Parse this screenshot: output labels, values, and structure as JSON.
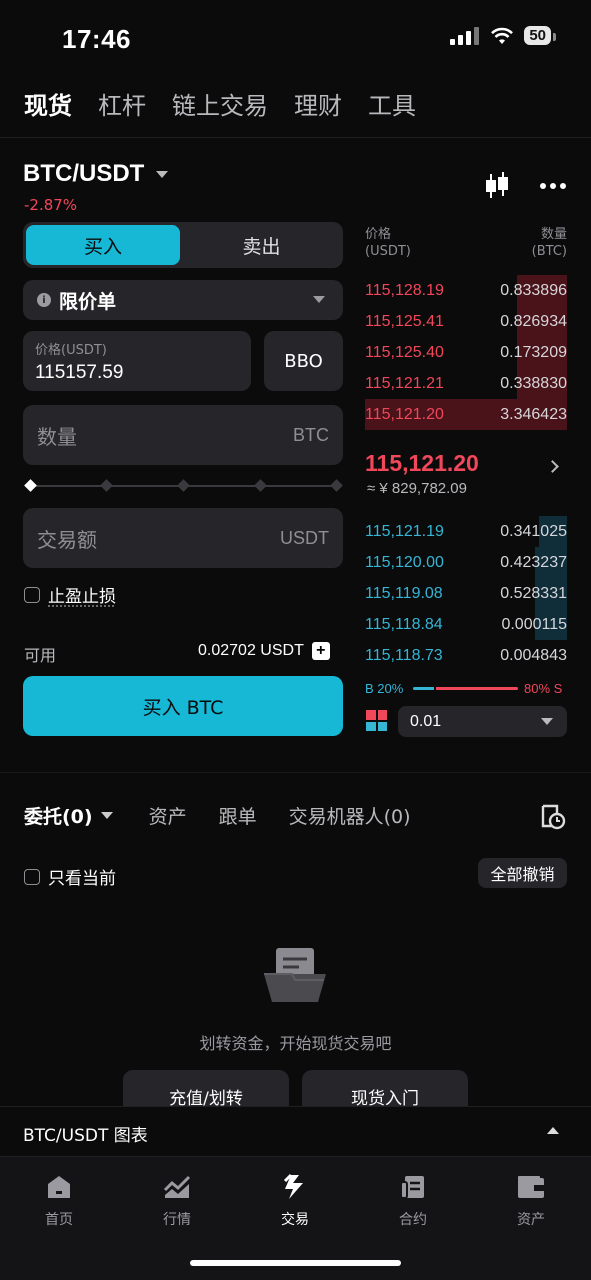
{
  "status": {
    "time": "17:46",
    "battery": "50"
  },
  "top_tabs": [
    "现货",
    "杠杆",
    "链上交易",
    "理财",
    "工具"
  ],
  "pair": {
    "name": "BTC/USDT",
    "change": "-2.87%"
  },
  "order_form": {
    "buy_label": "买入",
    "sell_label": "卖出",
    "order_type": "限价单",
    "price_label": "价格(USDT)",
    "price_value": "115157.59",
    "bbo_label": "BBO",
    "qty_placeholder": "数量",
    "qty_unit": "BTC",
    "amount_placeholder": "交易额",
    "amount_unit": "USDT",
    "tpsl_label": "止盈止损",
    "available_label": "可用",
    "available_value": "0.02702 USDT",
    "submit_label": "买入 BTC"
  },
  "order_book": {
    "price_header": "价格",
    "price_unit": "(USDT)",
    "qty_header": "数量",
    "qty_unit": "(BTC)",
    "asks": [
      {
        "price": "115,128.19",
        "qty": "0.833896",
        "depth": 0.25
      },
      {
        "price": "115,125.41",
        "qty": "0.826934",
        "depth": 0.25
      },
      {
        "price": "115,125.40",
        "qty": "0.173209",
        "depth": 0.25
      },
      {
        "price": "115,121.21",
        "qty": "0.338830",
        "depth": 0.25
      },
      {
        "price": "115,121.20",
        "qty": "3.346423",
        "depth": 1.0
      }
    ],
    "last_price": "115,121.20",
    "last_price_cny": "≈ ¥ 829,782.09",
    "bids": [
      {
        "price": "115,121.19",
        "qty": "0.341025",
        "depth": 0.14
      },
      {
        "price": "115,120.00",
        "qty": "0.423237",
        "depth": 0.16
      },
      {
        "price": "115,119.08",
        "qty": "0.528331",
        "depth": 0.16
      },
      {
        "price": "115,118.84",
        "qty": "0.000115",
        "depth": 0.16
      },
      {
        "price": "115,118.73",
        "qty": "0.004843",
        "depth": 0.0
      }
    ],
    "buy_ratio_label": "B 20%",
    "sell_ratio_label": "80% S",
    "buy_ratio": 0.2,
    "depth_value": "0.01"
  },
  "orders": {
    "tabs": [
      "委托(0)",
      "资产",
      "跟单",
      "交易机器人(0)"
    ],
    "only_current": "只看当前",
    "cancel_all": "全部撤销",
    "empty_text": "划转资金，开始现货交易吧",
    "btn_deposit": "充值/划转",
    "btn_intro": "现货入门"
  },
  "chart_bar": {
    "label": "BTC/USDT  图表"
  },
  "bottom_nav": [
    "首页",
    "行情",
    "交易",
    "合约",
    "资产"
  ],
  "colors": {
    "accent": "#17b8d6",
    "sell": "#f0475a",
    "buy": "#36b5d4"
  }
}
